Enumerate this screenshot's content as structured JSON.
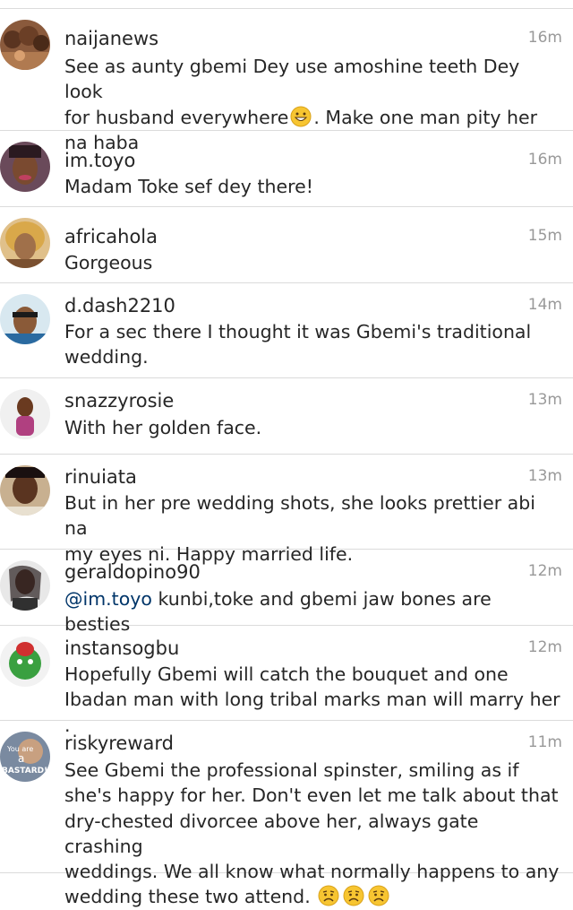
{
  "comments": [
    {
      "user": "naijanews",
      "time": "16m",
      "text": "See as aunty gbemi Dey use amoshine teeth Dey look\nfor husband everywhere",
      "text_after": ". Make one man pity her\nna haba"
    },
    {
      "user": "im.toyo",
      "time": "16m",
      "text": "Madam Toke sef dey there!"
    },
    {
      "user": "africahola",
      "time": "15m",
      "text": "Gorgeous"
    },
    {
      "user": "d.dash2210",
      "time": "14m",
      "text": "For a sec there I thought it was Gbemi's traditional\nwedding."
    },
    {
      "user": "snazzyrosie",
      "time": "13m",
      "text": "With her golden face."
    },
    {
      "user": "rinuiata",
      "time": "13m",
      "text": "But in her pre wedding shots, she looks prettier abi na\nmy eyes ni. Happy married life."
    },
    {
      "user": "geraldopino90",
      "time": "12m",
      "mention": "@im.toyo",
      "text": " kunbi,toke and gbemi jaw bones are besties"
    },
    {
      "user": "instansogbu",
      "time": "12m",
      "text": "Hopefully Gbemi will catch the bouquet and one\nIbadan man with long tribal marks man will marry her ."
    },
    {
      "user": "riskyreward",
      "time": "11m",
      "avatar_text": [
        "You are",
        "a",
        "BASTARD!!"
      ],
      "text": "See Gbemi the professional spinster, smiling as if\nshe's happy for her. Don't even let me talk about that\ndry-chested divorcee above her, always gate crashing\nweddings. We all know what normally happens to any\nwedding these two attend."
    }
  ],
  "emoji": {
    "grin": "grinning-face",
    "worried": "worried-face"
  },
  "colors": {
    "username": "#262626",
    "timestamp": "#999999",
    "mention": "#003569",
    "divider": "#dbdbdb"
  }
}
